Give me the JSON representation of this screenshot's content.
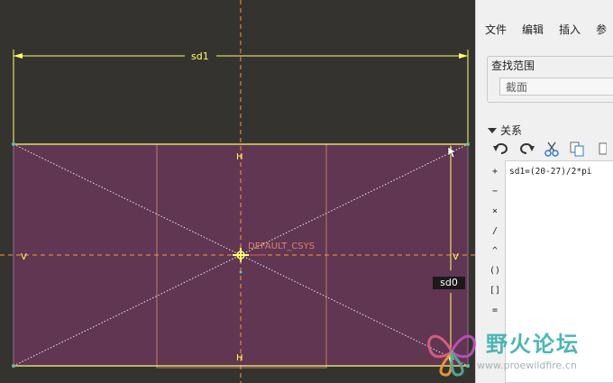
{
  "viewport": {
    "dim_top_label": "sd1",
    "dim_right_label": "sd0",
    "h_label": "H",
    "v_label": "V",
    "csys_label": "DEFAULT_CSYS",
    "colors": {
      "background": "#353330",
      "sketch_fill": "#603653",
      "dimension": "#ffff66",
      "centerline": "#ff9933",
      "reference": "#d08060"
    }
  },
  "panel": {
    "menu": [
      "文件",
      "编辑",
      "插入",
      "参"
    ],
    "find": {
      "title": "查找范围",
      "value": "截面"
    },
    "relations_label": "关系",
    "toolbar_icons": [
      "undo-icon",
      "redo-icon",
      "cut-icon",
      "copy-icon",
      "paste-icon"
    ],
    "operators": [
      "+",
      "−",
      "×",
      "/",
      "^",
      "()",
      "[]",
      "="
    ],
    "relation_text": "sd1=(20-27)/2*pi"
  },
  "watermark": {
    "text_cn": "野火论坛",
    "url": "www.proewildfire.cn"
  }
}
